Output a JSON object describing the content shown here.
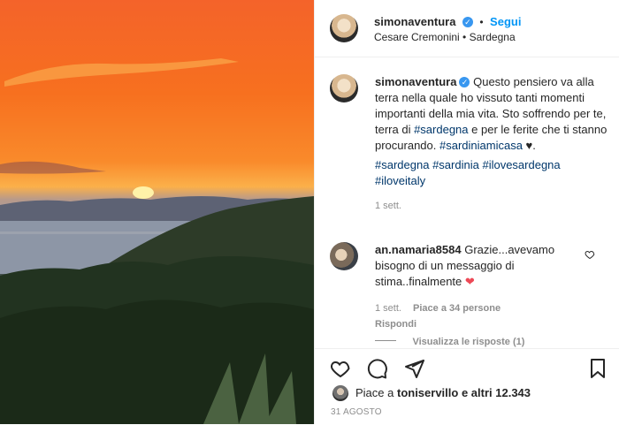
{
  "post": {
    "author": {
      "username": "simonaventura",
      "verified": true
    },
    "follow_separator": "•",
    "follow_label": "Segui",
    "location": "Cesare Cremonini • Sardegna",
    "caption": {
      "text": "Questo pensiero va alla terra nella quale ho vissuto tanti momenti importanti della mia vita. Sto soffrendo per te, terra di ",
      "tag1": "#sardegna",
      "text2": " e per le ferite che ti stanno procurando. ",
      "tag2": "#sardiniamicasa",
      "after_tag2": " ♥.",
      "hashtags": [
        "#sardegna",
        "#sardinia",
        "#ilovesardegna",
        "#iloveitaly"
      ],
      "time": "1 sett."
    },
    "comment": {
      "username": "an.namaria8584",
      "text": "Grazie...avevamo bisogno di un messaggio di stima..finalmente",
      "emoji": "❤",
      "time": "1 sett.",
      "likes": "Piace a 34 persone",
      "reply": "Rispondi",
      "view_replies": "Visualizza le risposte (1)"
    },
    "likes": {
      "prefix": "Piace a ",
      "user": "toniservillo",
      "suffix": " e altri 12.343"
    },
    "date": "31 AGOSTO"
  },
  "icons": [
    "heart-icon",
    "comment-icon",
    "share-icon",
    "bookmark-icon",
    "comment-like-heart-icon"
  ],
  "colors": {
    "link": "#0095f6",
    "hashtag": "#00376b",
    "muted": "#8e8e8e",
    "verified": "#3897f0",
    "like_red": "#ed4956"
  }
}
